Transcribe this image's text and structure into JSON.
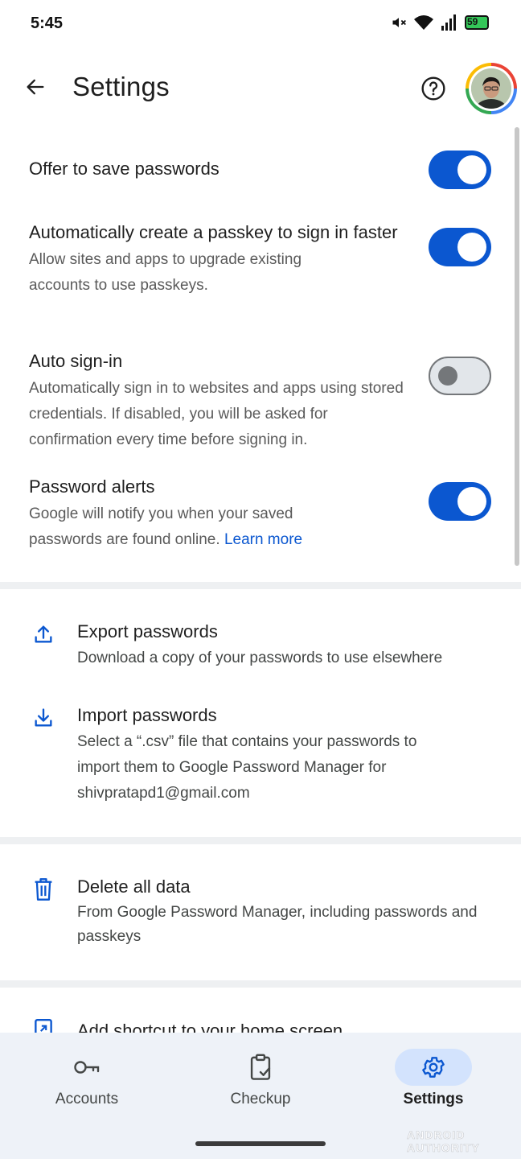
{
  "status_bar": {
    "time": "5:45",
    "battery": "59"
  },
  "header": {
    "title": "Settings"
  },
  "settings": [
    {
      "title": "Offer to save passwords",
      "description": "",
      "enabled": true
    },
    {
      "title": "Automatically create a passkey to sign in faster",
      "description": "Allow sites and apps to upgrade existing accounts to use passkeys.",
      "enabled": true
    },
    {
      "title": "Auto sign-in",
      "description": "Automatically sign in to websites and apps using stored credentials. If disabled, you will be asked for confirmation every time before signing in.",
      "enabled": false
    },
    {
      "title": "Password alerts",
      "description": "Google will notify you when your saved passwords are found online.",
      "link": "Learn more",
      "enabled": true
    }
  ],
  "actions": {
    "export": {
      "title": "Export passwords",
      "description": "Download a copy of your passwords to use elsewhere"
    },
    "import": {
      "title": "Import passwords",
      "description": "Select a “.csv” file that contains your passwords to import them to Google Password Manager for shivpratapd1@gmail.com"
    },
    "delete": {
      "title": "Delete all data",
      "description": "From Google Password Manager, including passwords and passkeys"
    },
    "shortcut": {
      "title": "Add shortcut to your home screen"
    }
  },
  "bottom_nav": [
    {
      "label": "Accounts",
      "icon": "key-icon",
      "active": false
    },
    {
      "label": "Checkup",
      "icon": "clipboard-check-icon",
      "active": false
    },
    {
      "label": "Settings",
      "icon": "gear-icon",
      "active": true
    }
  ],
  "watermark": "ANDROID AUTHORITY",
  "colors": {
    "accent": "#0b57d0",
    "nav_background": "#eef2f8",
    "nav_active_pill": "#d3e3fd"
  }
}
